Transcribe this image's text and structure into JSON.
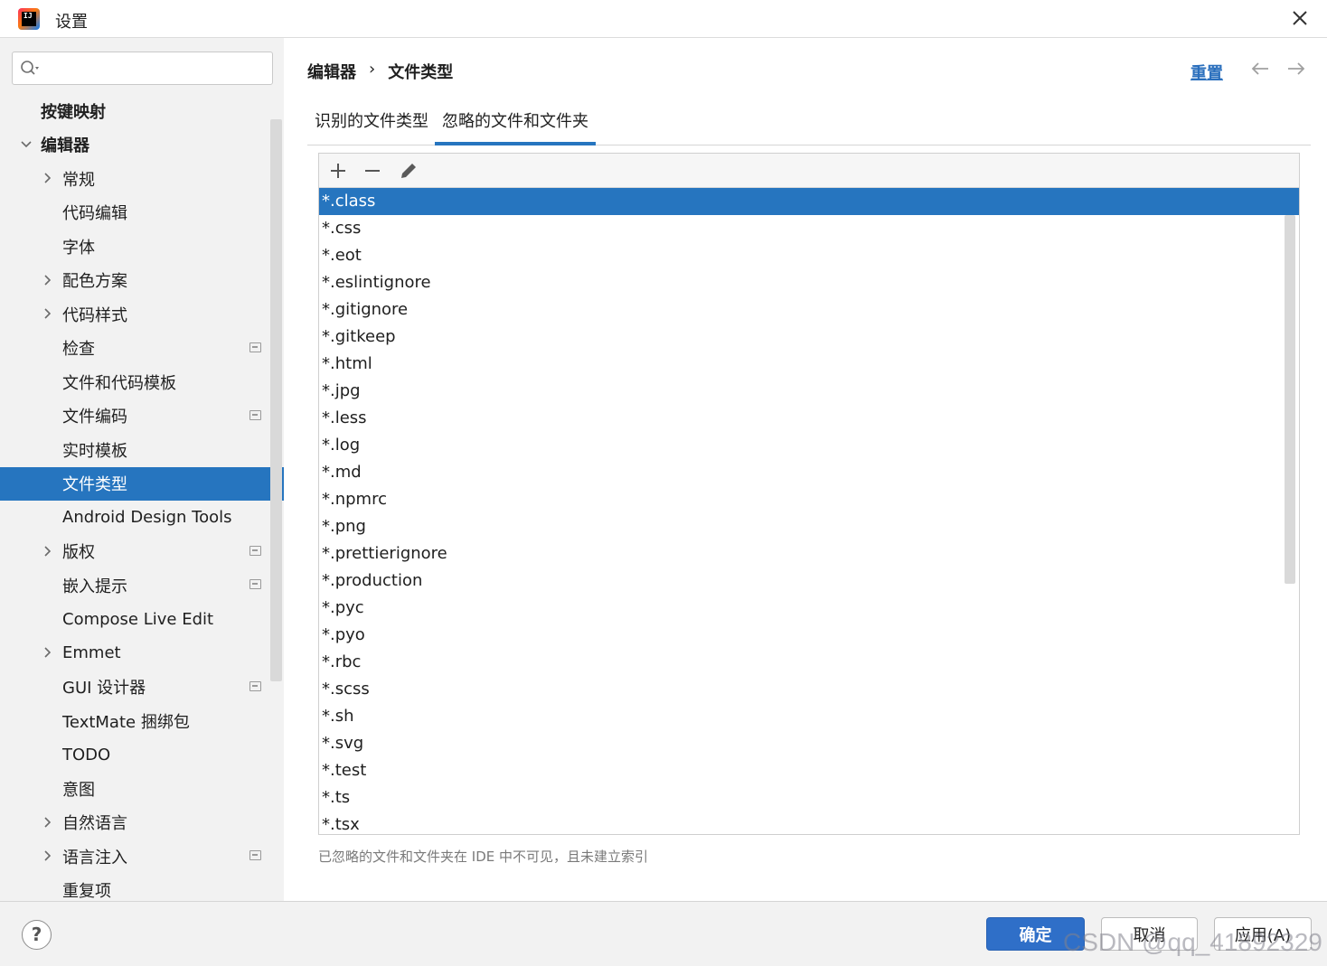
{
  "window": {
    "title": "设置",
    "logo_text": "IJ"
  },
  "sidebar": {
    "search": {
      "value": "",
      "placeholder": ""
    },
    "items": [
      {
        "label": "按键映射",
        "bold": true
      },
      {
        "label": "编辑器",
        "bold": true,
        "expanded": true
      },
      {
        "label": "常规",
        "has_children": true
      },
      {
        "label": "代码编辑"
      },
      {
        "label": "字体"
      },
      {
        "label": "配色方案",
        "has_children": true
      },
      {
        "label": "代码样式",
        "has_children": true
      },
      {
        "label": "检查",
        "project_icon": true
      },
      {
        "label": "文件和代码模板"
      },
      {
        "label": "文件编码",
        "project_icon": true
      },
      {
        "label": "实时模板"
      },
      {
        "label": "文件类型",
        "selected": true
      },
      {
        "label": "Android Design Tools"
      },
      {
        "label": "版权",
        "has_children": true,
        "project_icon": true
      },
      {
        "label": "嵌入提示",
        "project_icon": true
      },
      {
        "label": "Compose Live Edit"
      },
      {
        "label": "Emmet",
        "has_children": true
      },
      {
        "label": "GUI 设计器",
        "project_icon": true
      },
      {
        "label": "TextMate 捆绑包"
      },
      {
        "label": "TODO"
      },
      {
        "label": "意图"
      },
      {
        "label": "自然语言",
        "has_children": true
      },
      {
        "label": "语言注入",
        "has_children": true,
        "project_icon": true
      },
      {
        "label": "重复项"
      }
    ]
  },
  "main": {
    "breadcrumb": {
      "parent": "编辑器",
      "separator": "›",
      "current": "文件类型"
    },
    "reset_label": "重置",
    "tabs": [
      {
        "label": "识别的文件类型",
        "active": false
      },
      {
        "label": "忽略的文件和文件夹",
        "active": true
      }
    ],
    "toolbar": {
      "add": "+",
      "remove": "−"
    },
    "ignored_patterns": [
      "*.class",
      "*.css",
      "*.eot",
      "*.eslintignore",
      "*.gitignore",
      "*.gitkeep",
      "*.html",
      "*.jpg",
      "*.less",
      "*.log",
      "*.md",
      "*.npmrc",
      "*.png",
      "*.prettierignore",
      "*.production",
      "*.pyc",
      "*.pyo",
      "*.rbc",
      "*.scss",
      "*.sh",
      "*.svg",
      "*.test",
      "*.ts",
      "*.tsx"
    ],
    "selected_pattern": "*.class",
    "hint": "已忽略的文件和文件夹在 IDE 中不可见，且未建立索引"
  },
  "footer": {
    "help_label": "?",
    "ok_label": "确定",
    "cancel_label": "取消",
    "apply_label": "应用(A)"
  },
  "watermark": "CSDN @qq_41892329",
  "colors": {
    "accent": "#2675bf",
    "link": "#2a6fbd",
    "sidebar_bg": "#f2f2f2"
  }
}
